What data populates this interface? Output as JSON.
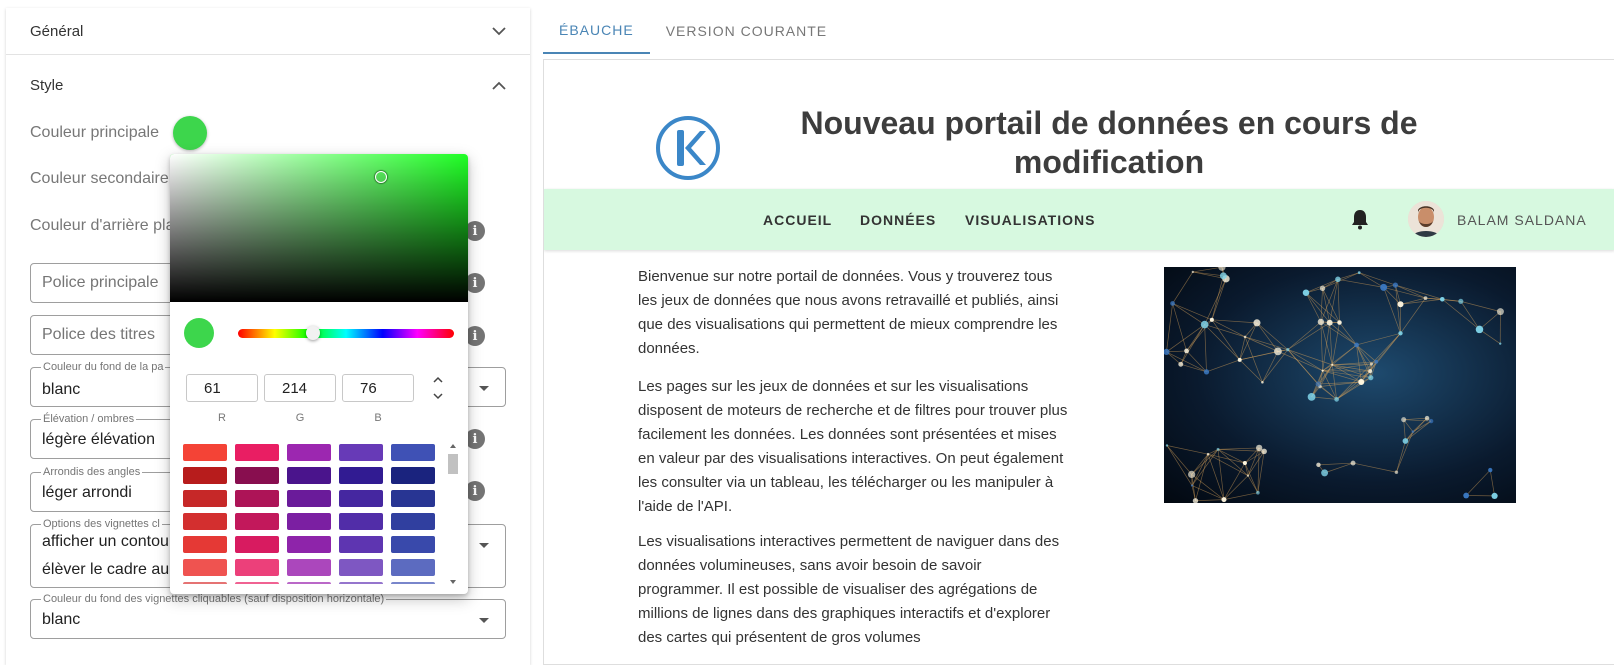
{
  "settings": {
    "general_label": "Général",
    "style_label": "Style",
    "primary_color_label": "Couleur principale",
    "secondary_color_label": "Couleur secondaire",
    "background_color_label": "Couleur d'arrière pla",
    "primary_color_value": "#3dd64c",
    "main_font_placeholder": "Police principale",
    "title_font_placeholder": "Police des titres",
    "page_bg_label": "Couleur du fond de la pa",
    "page_bg_value": "blanc",
    "elevation_label": "Élévation / ombres",
    "elevation_value": "légère élévation",
    "corners_label": "Arrondis des angles",
    "corners_value": "léger arrondi",
    "cards_options_label": "Options des vignettes cl",
    "cards_options_value1": "afficher un contou",
    "cards_options_value2": "élèver le cadre au",
    "cards_bg_label": "Couleur du fond des vignettes cliquables (sauf disposition horizontale)",
    "cards_bg_value": "blanc"
  },
  "picker": {
    "r": "61",
    "g": "214",
    "b": "76",
    "r_label": "R",
    "g_label": "G",
    "b_label": "B",
    "palette": [
      [
        "#f44336",
        "#e91e63",
        "#9c27b0",
        "#673ab7",
        "#3f51b5"
      ],
      [
        "#b71c1c",
        "#880e4f",
        "#4a148c",
        "#311b92",
        "#1a237e"
      ],
      [
        "#c62828",
        "#ad1457",
        "#6a1b9a",
        "#4527a0",
        "#283593"
      ],
      [
        "#d32f2f",
        "#c2185b",
        "#7b1fa2",
        "#512da8",
        "#303f9f"
      ],
      [
        "#e53935",
        "#d81b60",
        "#8e24aa",
        "#5e35b1",
        "#3949ab"
      ],
      [
        "#ef5350",
        "#ec407a",
        "#ab47bc",
        "#7e57c2",
        "#5c6bc0"
      ],
      [
        "#e57373",
        "#f06292",
        "#ba68c8",
        "#9575cd",
        "#7986cb"
      ]
    ]
  },
  "tabs": {
    "draft": "ÉBAUCHE",
    "current": "VERSION COURANTE"
  },
  "preview": {
    "title": "Nouveau portail de données en cours de modification",
    "nav": {
      "home": "ACCUEIL",
      "data": "DONNÉES",
      "viz": "VISUALISATIONS",
      "user": "BALAM SALDANA"
    },
    "para1": "Bienvenue sur notre portail de données. Vous y trouverez tous les jeux de données que nous avons retravaillé et publiés, ainsi que des visualisations qui permettent de mieux comprendre les données.",
    "para2": "Les pages sur les jeux de données et sur les visualisations disposent de moteurs de recherche et de filtres pour trouver plus facilement les données. Les données sont présentées et mises en valeur par des visualisations interactives. On peut également les consulter via un tableau, les télécharger ou les manipuler à l'aide de l'API.",
    "para3": "Les visualisations interactives permettent de naviguer dans des données volumineuses, sans avoir besoin de savoir programmer. Il est possible de visualiser des agrégations de millions de lignes dans des graphiques interactifs et d'explorer des cartes qui présentent de gros volumes",
    "nav_bg_color": "#d7f9e0",
    "accent_color": "#4a85b5"
  }
}
